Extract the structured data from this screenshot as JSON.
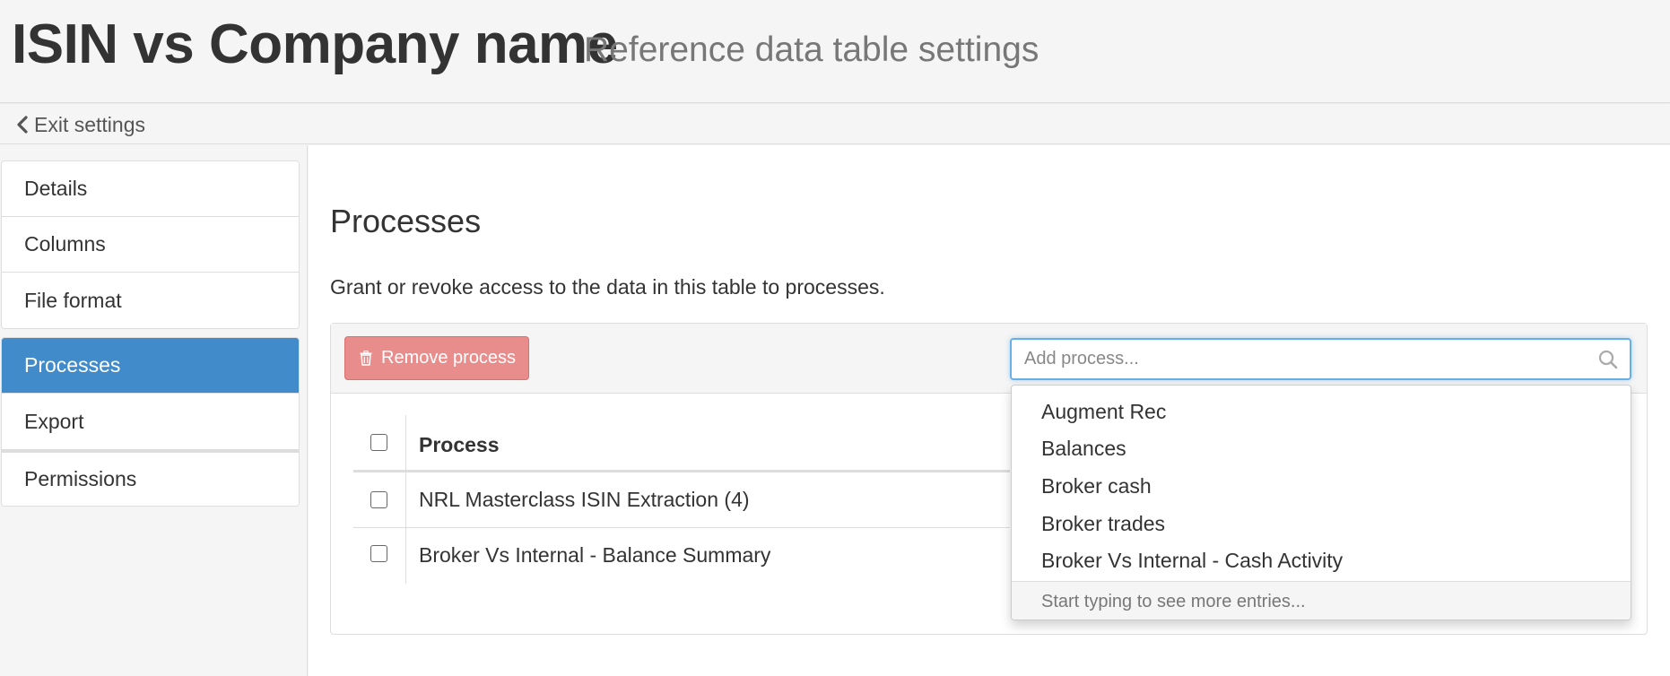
{
  "header": {
    "title": "ISIN vs Company name",
    "subtitle": "Reference data table settings"
  },
  "exit": {
    "label": "Exit settings"
  },
  "sidebar": {
    "items": [
      {
        "label": "Details"
      },
      {
        "label": "Columns"
      },
      {
        "label": "File format"
      },
      {
        "label": "Processes",
        "active": true
      },
      {
        "label": "Export"
      },
      {
        "label": "Permissions"
      }
    ]
  },
  "main": {
    "title": "Processes",
    "description": "Grant or revoke access to the data in this table to processes.",
    "remove_button": "Remove process",
    "search": {
      "placeholder": "Add process...",
      "value": ""
    },
    "table": {
      "header": "Process",
      "rows": [
        {
          "name": "NRL Masterclass ISIN Extraction (4)"
        },
        {
          "name": "Broker Vs Internal - Balance Summary"
        }
      ]
    },
    "dropdown": {
      "options": [
        "Augment Rec",
        "Balances",
        "Broker cash",
        "Broker trades",
        "Broker Vs Internal - Cash Activity"
      ],
      "footer": "Start typing to see more entries..."
    }
  },
  "colors": {
    "accent": "#428bca",
    "danger_button": "#e88d8b",
    "focus_border": "#66afe9"
  },
  "icons": {
    "exit": "chevron-left-icon",
    "remove": "trash-icon",
    "search": "search-icon"
  }
}
